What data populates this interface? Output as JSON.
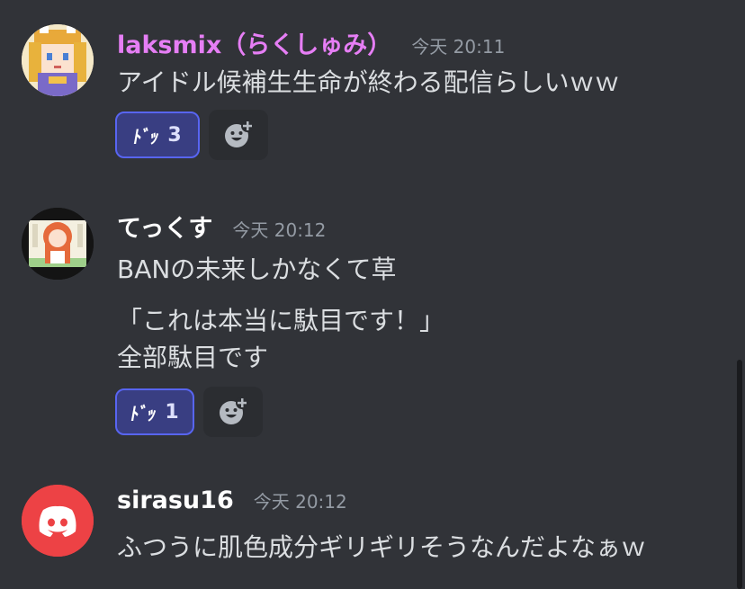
{
  "messages": [
    {
      "username": "laksmix（らくしゅみ）",
      "username_color": "#e67ef5",
      "timestamp": "今天 20:11",
      "lines": [
        "アイドル候補生生命が終わる配信らしいｗｗ"
      ],
      "reactions": [
        {
          "emoji": "ﾄﾞｯ",
          "count": "3"
        }
      ]
    },
    {
      "username": "てっくす",
      "username_color": "#ffffff",
      "timestamp": "今天 20:12",
      "lines": [
        "BANの未来しかなくて草",
        "「これは本当に駄目です！」",
        "全部駄目です"
      ],
      "reactions": [
        {
          "emoji": "ﾄﾞｯ",
          "count": "1"
        }
      ]
    },
    {
      "username": "sirasu16",
      "username_color": "#ffffff",
      "timestamp": "今天 20:12",
      "lines": [
        "ふつうに肌色成分ギリギリそうなんだよなぁｗ"
      ],
      "reactions": []
    }
  ],
  "icons": {
    "add_reaction": "add-reaction-icon",
    "discord_avatar": "discord-logo-icon"
  },
  "colors": {
    "background": "#313338",
    "reaction_bg": "#393e82",
    "reaction_border": "#5865f2",
    "discord_red": "#ed4245"
  }
}
